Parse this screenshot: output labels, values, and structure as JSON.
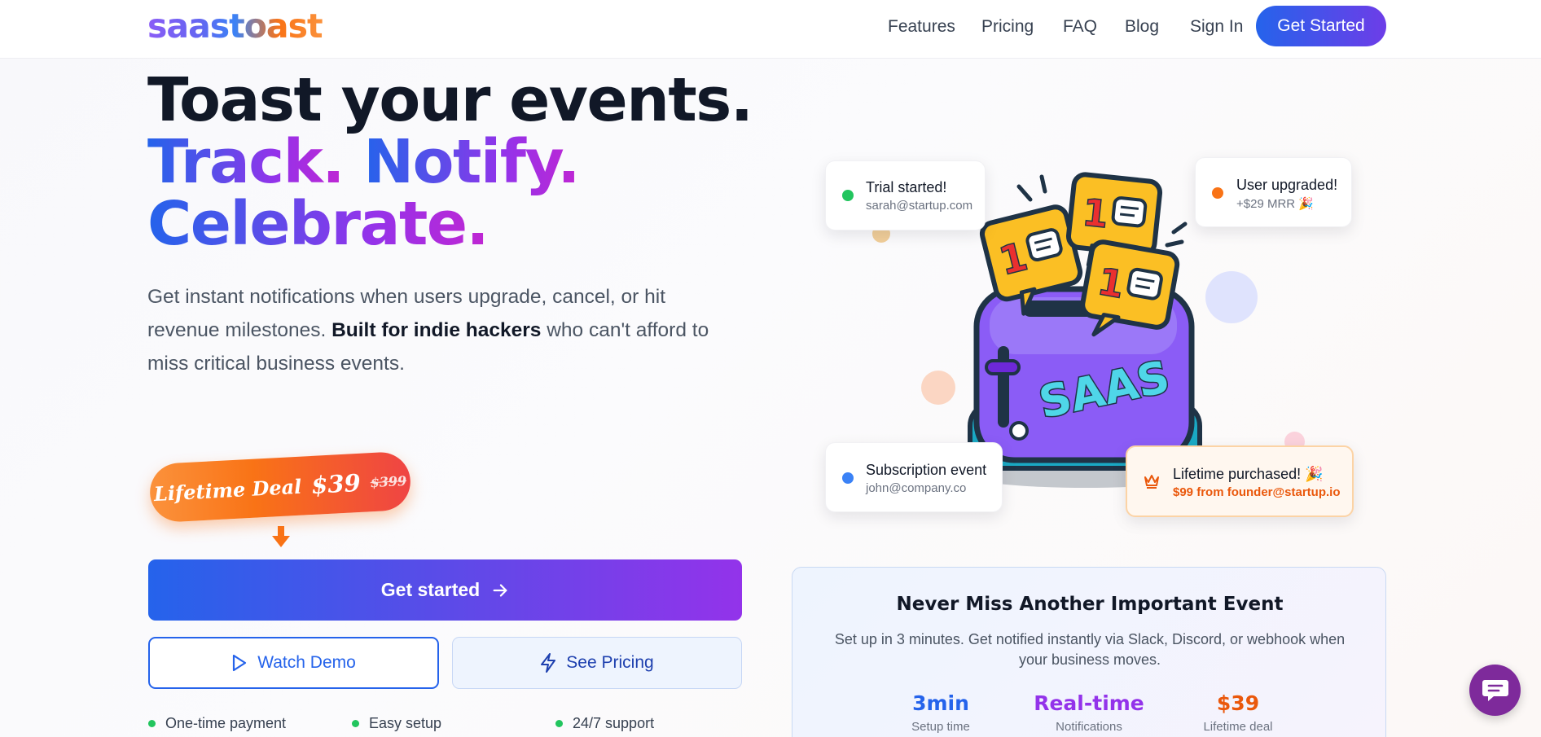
{
  "nav": {
    "logo": "saastoast",
    "links": [
      "Features",
      "Pricing",
      "FAQ",
      "Blog",
      "Sign In"
    ],
    "cta": "Get Started"
  },
  "hero": {
    "line1": "Toast your events.",
    "line2_a": "Track.",
    "line2_b": "Notify.",
    "line3": "Celebrate.",
    "desc_before": "Get instant notifications when users upgrade, cancel, or hit revenue milestones. ",
    "desc_bold": "Built for indie hackers",
    "desc_after": " who can't afford to miss critical business events.",
    "deal_label": "Lifetime Deal",
    "deal_price": "$39",
    "deal_old_price": "$399",
    "cta_main": "Get started",
    "demo_label": "Watch Demo",
    "pricing_label": "See Pricing",
    "features": [
      "One-time payment",
      "Easy setup",
      "24/7 support"
    ]
  },
  "notifications": [
    {
      "title": "Trial started!",
      "sub": "sarah@startup.com",
      "color": "#22c55e"
    },
    {
      "title": "User upgraded!",
      "sub": "+$29 MRR 🎉",
      "color": "#f97316"
    },
    {
      "title": "Subscription event",
      "sub": "john@company.co",
      "color": "#3b82f6"
    },
    {
      "title": "Lifetime purchased! 🎉",
      "sub": "$99 from founder@startup.io",
      "color": "#ea580c"
    }
  ],
  "toaster": {
    "label": "SAAS",
    "badge": "1"
  },
  "info": {
    "title": "Never Miss Another Important Event",
    "desc": "Set up in 3 minutes. Get notified instantly via Slack, Discord, or webhook when your business moves.",
    "stats": [
      {
        "value": "3min",
        "label": "Setup time",
        "color": "#2563eb"
      },
      {
        "value": "Real-time",
        "label": "Notifications",
        "color": "#9333ea"
      },
      {
        "value": "$39",
        "label": "Lifetime deal",
        "color": "#ea580c"
      }
    ]
  }
}
